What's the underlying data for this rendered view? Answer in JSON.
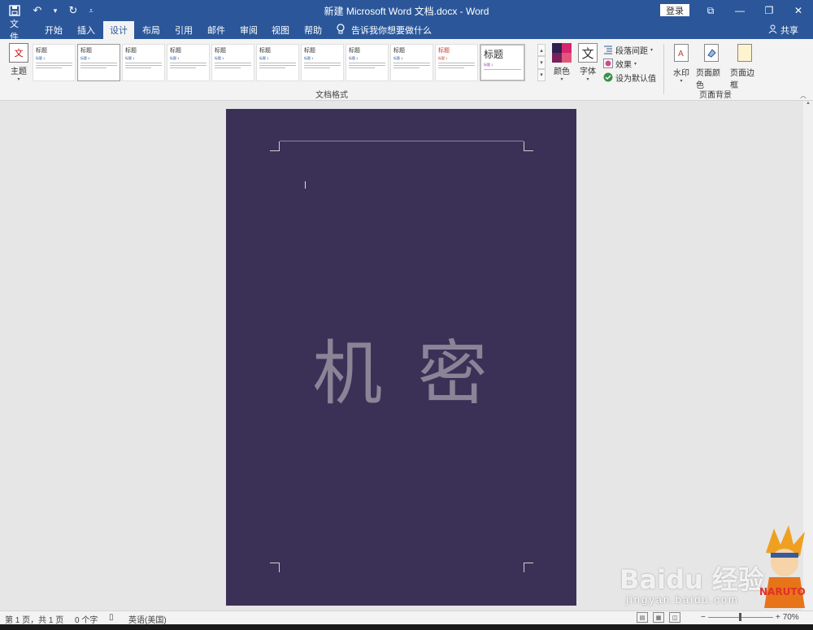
{
  "window": {
    "title": "新建 Microsoft Word 文档.docx  -  Word",
    "login": "登录",
    "colors": {
      "titlebar": "#2b579a",
      "page_background": "#3b3157",
      "watermark_text": "#8b8497"
    }
  },
  "qat": {
    "save_icon": "save-icon",
    "undo_icon": "undo-icon",
    "redo_icon": "redo-icon",
    "customize_icon": "customize-icon"
  },
  "tabs": [
    {
      "label": "文件",
      "active": false
    },
    {
      "label": "开始",
      "active": false
    },
    {
      "label": "插入",
      "active": false
    },
    {
      "label": "设计",
      "active": true
    },
    {
      "label": "布局",
      "active": false
    },
    {
      "label": "引用",
      "active": false
    },
    {
      "label": "邮件",
      "active": false
    },
    {
      "label": "审阅",
      "active": false
    },
    {
      "label": "视图",
      "active": false
    },
    {
      "label": "帮助",
      "active": false
    }
  ],
  "tell_me": "告诉我你想要做什么",
  "share": "共享",
  "ribbon": {
    "theme": "主题",
    "theme_icon_text": "文",
    "style_gallery": [
      {
        "title": "标题",
        "heading": "标题 1"
      },
      {
        "title": "标题",
        "heading": "标题 1"
      },
      {
        "title": "标题",
        "heading": "标题 1"
      },
      {
        "title": "标题",
        "heading": "标题 1"
      },
      {
        "title": "标题",
        "heading": "标题 1"
      },
      {
        "title": "标题",
        "heading": "标题 1"
      },
      {
        "title": "标题",
        "heading": "标题 1"
      },
      {
        "title": "标题",
        "heading": "标题 1"
      },
      {
        "title": "标题",
        "heading": "标题 1"
      },
      {
        "title": "标题",
        "heading": "标题 1"
      },
      {
        "title": "标题",
        "heading": "标题 1"
      }
    ],
    "document_formatting_label": "文档格式",
    "colors": "颜色",
    "fonts": "字体",
    "font_icon_text": "文",
    "paragraph_spacing": "段落间距",
    "effects": "效果",
    "set_as_default": "设为默认值",
    "watermark": "水印",
    "page_color": "页面颜色",
    "page_borders": "页面边框",
    "page_background_label": "页面背景"
  },
  "document": {
    "watermark_text": "机 密"
  },
  "statusbar": {
    "page_info": "第 1 页，共 1 页",
    "word_count": "0 个字",
    "language": "英语(美国)",
    "zoom_level": "70%",
    "zoom_minus": "−",
    "zoom_plus": "+"
  },
  "baidu_watermark": {
    "logo": "Baidu 经验",
    "url": "jingyan.baidu.com"
  }
}
